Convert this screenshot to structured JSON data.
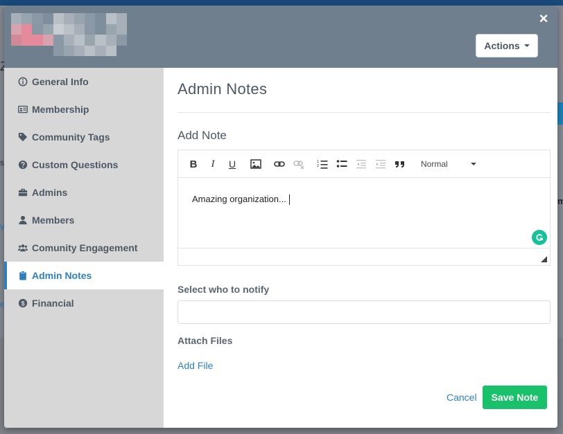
{
  "modal": {
    "close_symbol": "×",
    "actions_label": "Actions"
  },
  "sidebar": {
    "items": [
      {
        "label": "General Info",
        "icon": "info-circle-icon"
      },
      {
        "label": "Membership",
        "icon": "id-card-icon"
      },
      {
        "label": "Community Tags",
        "icon": "tag-icon"
      },
      {
        "label": "Custom Questions",
        "icon": "question-circle-icon"
      },
      {
        "label": "Admins",
        "icon": "briefcase-icon"
      },
      {
        "label": "Members",
        "icon": "user-icon"
      },
      {
        "label": "Comunity Engagement",
        "icon": "users-icon"
      },
      {
        "label": "Admin Notes",
        "icon": "clipboard-icon",
        "active": true
      },
      {
        "label": "Financial",
        "icon": "dollar-circle-icon"
      }
    ]
  },
  "content": {
    "title": "Admin Notes",
    "add_note_label": "Add Note",
    "editor": {
      "text": "Amazing organization...",
      "format_select": "Normal"
    },
    "notify_label": "Select who to notify",
    "attach_label": "Attach Files",
    "add_file_label": "Add File",
    "cancel_label": "Cancel",
    "save_label": "Save Note"
  },
  "colors": {
    "accent": "#2f7fbf",
    "save_green": "#19c26a",
    "header": "#6f7f8e",
    "sidebar_bg": "#d7d7d7"
  }
}
